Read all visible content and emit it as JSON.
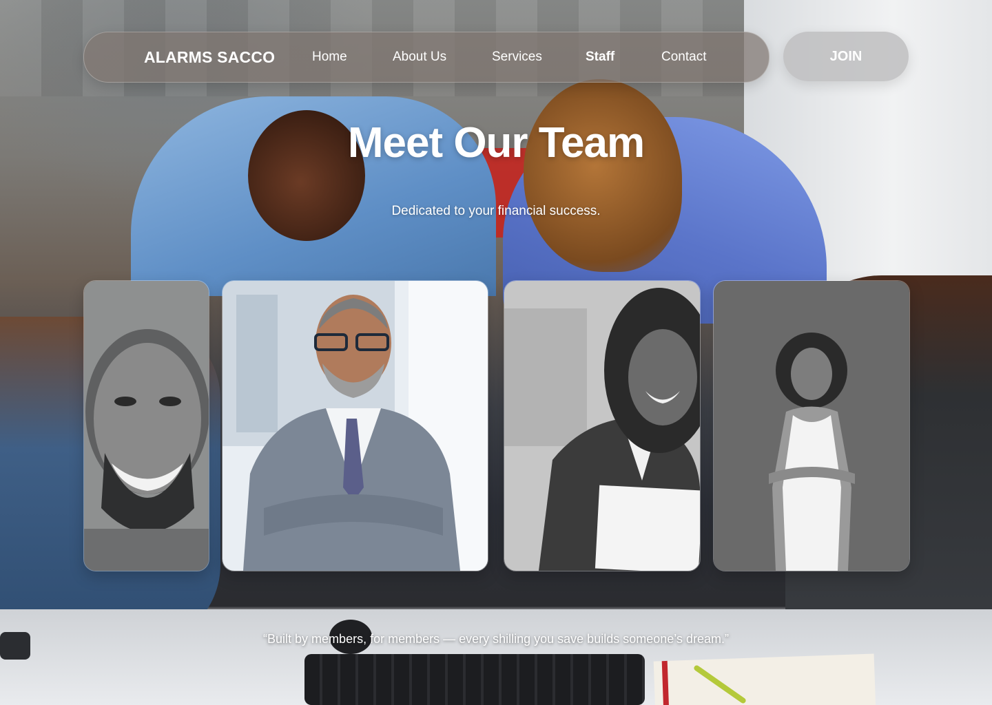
{
  "nav": {
    "brand": "ALARMS SACCO",
    "links": [
      {
        "label": "Home",
        "active": false
      },
      {
        "label": "About Us",
        "active": false
      },
      {
        "label": "Services",
        "active": false
      },
      {
        "label": "Staff",
        "active": true
      },
      {
        "label": "Contact",
        "active": false
      }
    ],
    "join_label": "JOIN"
  },
  "hero": {
    "title": "Meet Our Team",
    "subtitle": "Dedicated to your financial success."
  },
  "team": {
    "members": [
      {
        "photo": "smiling-man-closeup-grayscale"
      },
      {
        "photo": "man-in-grey-suit-arms-crossed-color"
      },
      {
        "photo": "woman-in-blazer-holding-folder-grayscale"
      },
      {
        "photo": "woman-in-white-dress-arms-crossed-grayscale"
      }
    ]
  },
  "quote": "“Built by members, for members — every shilling you save builds someone’s dream.”",
  "colors": {
    "nav_bg": "#80766f",
    "join_bg": "#bebec0",
    "text": "#ffffff",
    "shirt_blue": "#5f8fc6",
    "accent_red": "#c8221c"
  }
}
